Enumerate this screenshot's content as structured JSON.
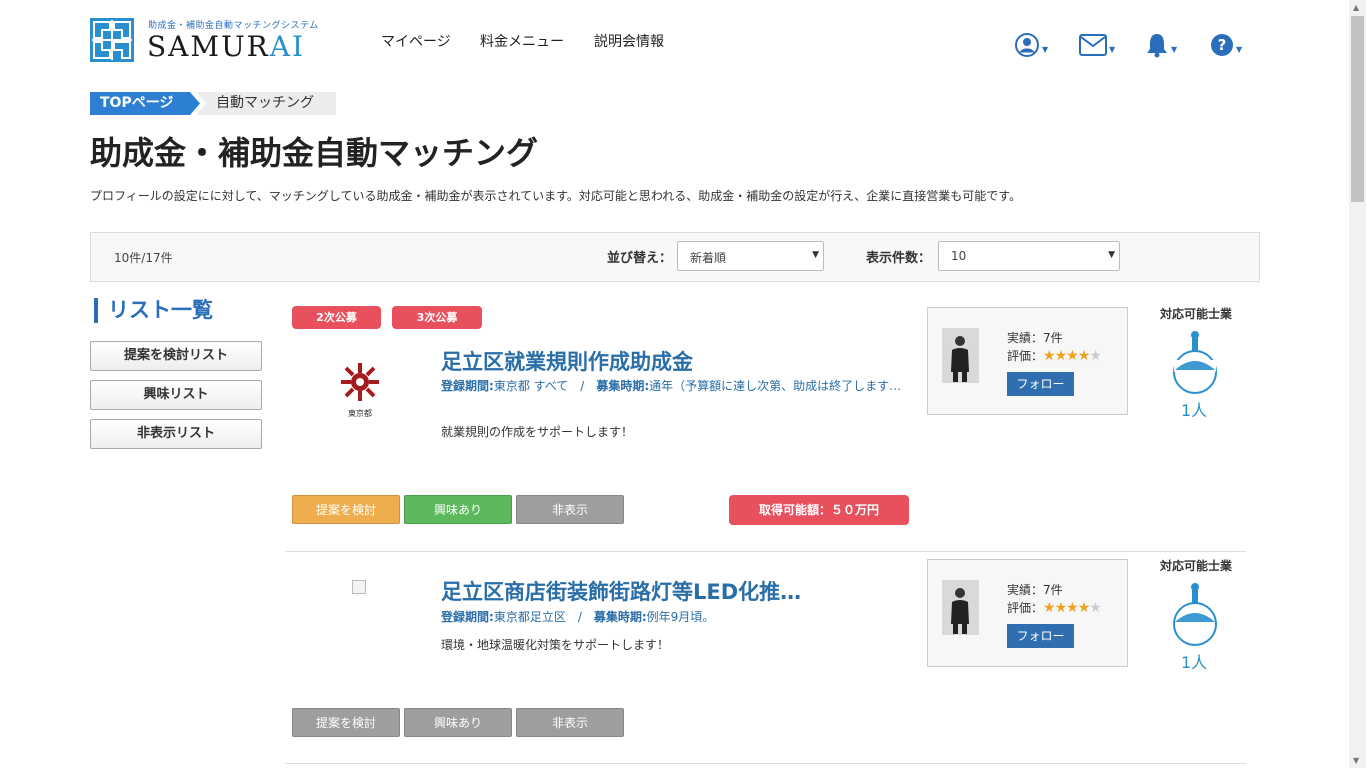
{
  "header": {
    "logo_tagline": "助成金・補助金自動マッチングシステム",
    "logo_word_a": "SAMUR",
    "logo_word_b": "AI",
    "nav": [
      "マイページ",
      "料金メニュー",
      "説明会情報"
    ],
    "icons": [
      "user-icon",
      "mail-icon",
      "bell-icon",
      "help-icon"
    ]
  },
  "breadcrumb": {
    "home": "TOPページ",
    "current": "自動マッチング"
  },
  "page": {
    "title": "助成金・補助金自動マッチング",
    "description": "プロフィールの設定にに対して、マッチングしている助成金・補助金が表示されています。対応可能と思われる、助成金・補助金の設定が行え、企業に直接営業も可能です。"
  },
  "toolbar": {
    "count": "10件/17件",
    "sort_label": "並び替え：",
    "sort_value": "新着順",
    "per_page_label": "表示件数：",
    "per_page_value": "10"
  },
  "sidebar": {
    "title": "リスト一覧",
    "buttons": [
      "提案を検討リスト",
      "興味リスト",
      "非表示リスト"
    ]
  },
  "cards": [
    {
      "tags": [
        "2次公募",
        "3次公募"
      ],
      "emblem_caption": "東京都",
      "title": "足立区就業規則作成助成金",
      "meta_label_1": "登録期間:",
      "meta_value_1": "東京都 すべて　/　",
      "meta_label_2": "募集時期:",
      "meta_value_2": "通年（予算額に達し次第、助成は終了します…",
      "summary": "就業規則の作成をサポートします！",
      "buttons": [
        "提案を検討",
        "興味あり",
        "非表示"
      ],
      "amount": "取得可能額：５０万円",
      "expert": {
        "record": "実績：7件",
        "rating_label": "評価：",
        "rating": 4,
        "follow": "フォロー"
      },
      "pro_label": "対応可能士業",
      "pro_count": "1人"
    },
    {
      "tags": [],
      "title": "足立区商店街装飾街路灯等LED化推…",
      "meta_label_1": "登録期間:",
      "meta_value_1": "東京都足立区　/　",
      "meta_label_2": "募集時期:",
      "meta_value_2": "例年9月頃。",
      "summary": "環境・地球温暖化対策をサポートします！",
      "buttons": [
        "提案を検討",
        "興味あり",
        "非表示"
      ],
      "expert": {
        "record": "実績：7件",
        "rating_label": "評価：",
        "rating": 4,
        "follow": "フォロー"
      },
      "pro_label": "対応可能士業",
      "pro_count": "1人"
    }
  ],
  "colors": {
    "primary": "#2a6ebb",
    "tag": "#e8505e",
    "consider": "#f0ad4e",
    "interest": "#5cb85c",
    "hide": "#9e9e9e",
    "hide_alt": "#9e9e9e"
  }
}
